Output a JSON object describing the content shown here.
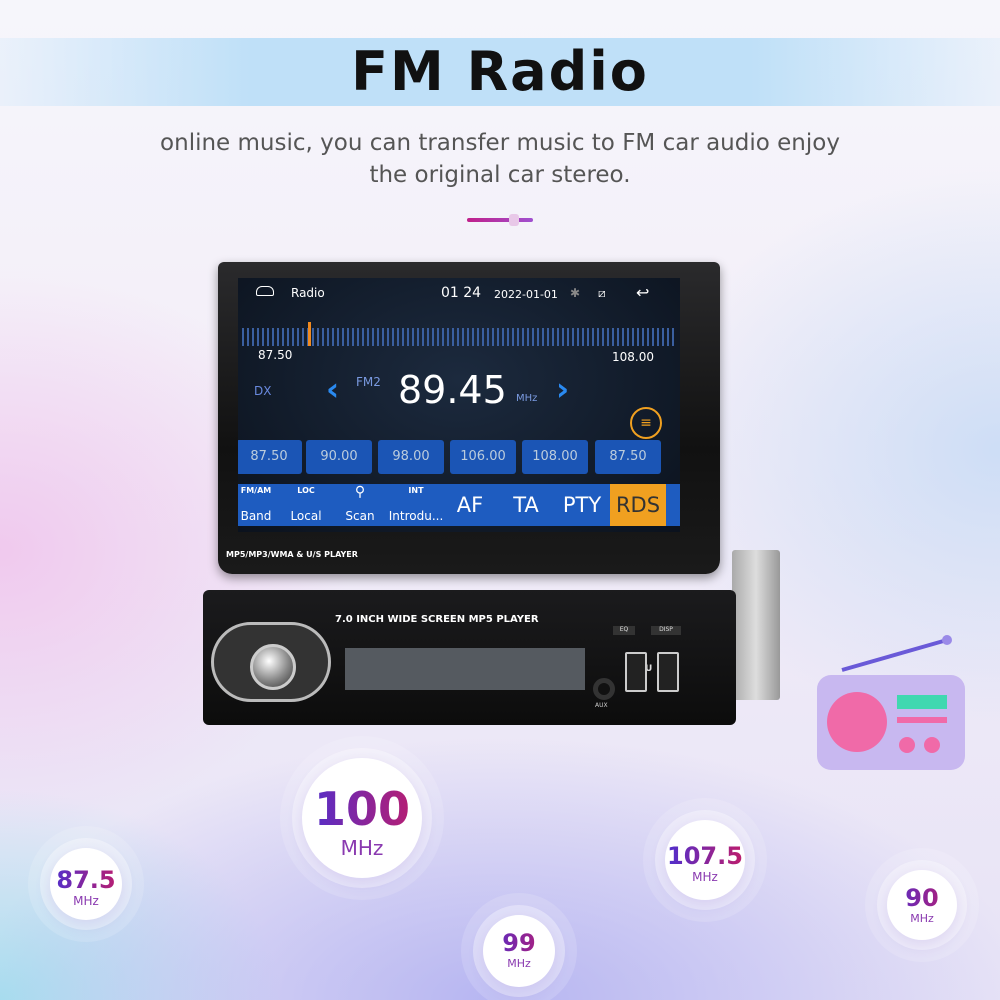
{
  "header": {
    "title": "FM Radio",
    "subtitle_line1": "online music, you can transfer music to FM car audio enjoy",
    "subtitle_line2": "the original car stereo."
  },
  "screen": {
    "app": "Radio",
    "time": "01 24",
    "date": "2022-01-01",
    "scale_min": "87.50",
    "scale_max": "108.00",
    "dx": "DX",
    "band": "FM2",
    "frequency": "89.45",
    "unit": "MHz",
    "presets": [
      "87.50",
      "90.00",
      "98.00",
      "106.00",
      "108.00",
      "87.50"
    ],
    "buttons": [
      {
        "icon": "FM/AM",
        "label": "Band"
      },
      {
        "icon": "LOC",
        "label": "Local"
      },
      {
        "icon": "search",
        "label": "Scan"
      },
      {
        "icon": "INT",
        "label": "Introdu..."
      },
      {
        "label": "AF"
      },
      {
        "label": "TA"
      },
      {
        "label": "PTY"
      },
      {
        "label": "RDS"
      }
    ],
    "accent": "#1e5cc0",
    "active_color": "#f0a020"
  },
  "device": {
    "bezel_label": "MP5/MP3/WMA & U/S PLAYER",
    "front_label": "7.0 INCH WIDE SCREEN   MP5  PLAYER",
    "eq": "EQ",
    "disp": "DISP",
    "aux": "AUX",
    "u": "U"
  },
  "frequencies": [
    {
      "value": "100",
      "unit": "MHz"
    },
    {
      "value": "87.5",
      "unit": "MHz"
    },
    {
      "value": "99",
      "unit": "MHz"
    },
    {
      "value": "107.5",
      "unit": "MHz"
    },
    {
      "value": "90",
      "unit": "MHz"
    }
  ]
}
